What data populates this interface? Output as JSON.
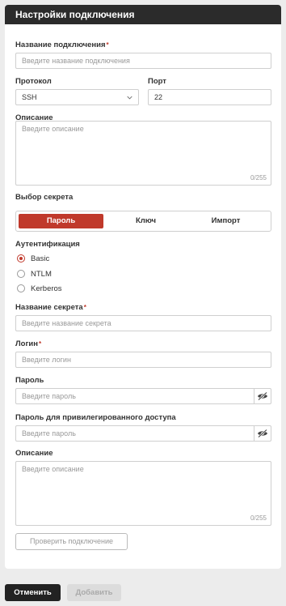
{
  "header": {
    "title": "Настройки подключения"
  },
  "connection_name": {
    "label": "Название подключения",
    "placeholder": "Введите название подключения"
  },
  "protocol": {
    "label": "Протокол",
    "value": "SSH"
  },
  "port": {
    "label": "Порт",
    "value": "22"
  },
  "description": {
    "label": "Описание",
    "placeholder": "Введите описание",
    "counter": "0/255"
  },
  "secret_choice": {
    "label": "Выбор секрета",
    "options": [
      "Пароль",
      "Ключ",
      "Импорт"
    ],
    "selected": "Пароль"
  },
  "auth": {
    "label": "Аутентификация",
    "options": [
      "Basic",
      "NTLM",
      "Kerberos"
    ],
    "selected": "Basic"
  },
  "secret_name": {
    "label": "Название секрета",
    "placeholder": "Введите название секрета"
  },
  "login": {
    "label": "Логин",
    "placeholder": "Введите логин"
  },
  "password": {
    "label": "Пароль",
    "placeholder": "Введите пароль"
  },
  "priv_password": {
    "label": "Пароль для привилегированного доступа",
    "placeholder": "Введите пароль"
  },
  "description2": {
    "label": "Описание",
    "placeholder": "Введите описание",
    "counter": "0/255"
  },
  "check_button": {
    "label": "Проверить подключение"
  },
  "footer": {
    "cancel_label": "Отменить",
    "add_label": "Добавить"
  },
  "colors": {
    "accent": "#c0392b",
    "header_bg": "#2b2b2b"
  },
  "required_mark": "*"
}
